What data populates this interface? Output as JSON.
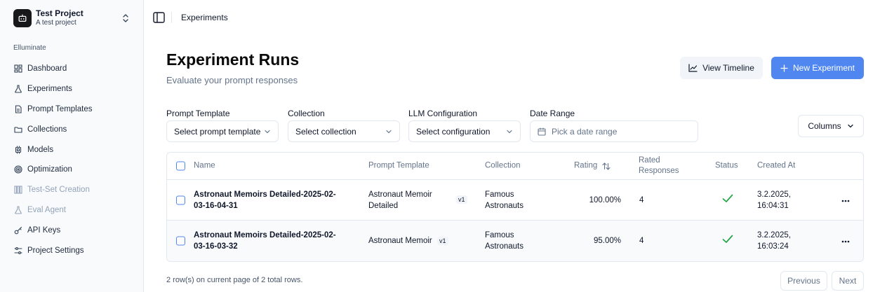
{
  "project": {
    "name": "Test Project",
    "subtitle": "A test project"
  },
  "sidebar": {
    "section": "Elluminate",
    "items": [
      {
        "label": "Dashboard",
        "icon": "grid-icon",
        "disabled": false
      },
      {
        "label": "Experiments",
        "icon": "flask-icon",
        "disabled": false
      },
      {
        "label": "Prompt Templates",
        "icon": "file-icon",
        "disabled": false
      },
      {
        "label": "Collections",
        "icon": "folder-icon",
        "disabled": false
      },
      {
        "label": "Models",
        "icon": "chip-icon",
        "disabled": false
      },
      {
        "label": "Optimization",
        "icon": "target-icon",
        "disabled": false
      },
      {
        "label": "Test-Set Creation",
        "icon": "bars-icon",
        "disabled": true
      },
      {
        "label": "Eval Agent",
        "icon": "flask-icon",
        "disabled": true
      },
      {
        "label": "API Keys",
        "icon": "key-icon",
        "disabled": false
      },
      {
        "label": "Project Settings",
        "icon": "sliders-icon",
        "disabled": false
      }
    ]
  },
  "breadcrumb": "Experiments",
  "page": {
    "title": "Experiment Runs",
    "subtitle": "Evaluate your prompt responses"
  },
  "actions": {
    "timeline": "View Timeline",
    "new": "New Experiment",
    "columns": "Columns"
  },
  "filters": [
    {
      "label": "Prompt Template",
      "value": "Select prompt template"
    },
    {
      "label": "Collection",
      "value": "Select collection"
    },
    {
      "label": "LLM Configuration",
      "value": "Select configuration"
    },
    {
      "label": "Date Range",
      "value": "Pick a date range"
    }
  ],
  "table": {
    "headers": {
      "name": "Name",
      "template": "Prompt Template",
      "collection": "Collection",
      "rating": "Rating",
      "rated_line1": "Rated",
      "rated_line2": "Responses",
      "status": "Status",
      "created": "Created At"
    },
    "rows": [
      {
        "name_line1": "Astronaut Memoirs Detailed-2025-02-",
        "name_line2": "03-16-04-31",
        "template_line1": "Astronaut Memoir",
        "template_line2": "Detailed",
        "version": "v1",
        "collection_line1": "Famous",
        "collection_line2": "Astronauts",
        "rating": "100.00%",
        "rated": "4",
        "created_line1": "3.2.2025,",
        "created_line2": "16:04:31"
      },
      {
        "name_line1": "Astronaut Memoirs Detailed-2025-02-",
        "name_line2": "03-16-03-32",
        "template_line1": "Astronaut Memoir",
        "template_line2": "",
        "version": "v1",
        "collection_line1": "Famous",
        "collection_line2": "Astronauts",
        "rating": "95.00%",
        "rated": "4",
        "created_line1": "3.2.2025,",
        "created_line2": "16:03:24"
      }
    ]
  },
  "footer": {
    "summary": "2 row(s) on current page of 2 total rows.",
    "prev": "Previous",
    "next": "Next"
  },
  "colors": {
    "primary": "#4f86f0",
    "success": "#22a447",
    "sidebar_bg": "#f8fafc"
  }
}
